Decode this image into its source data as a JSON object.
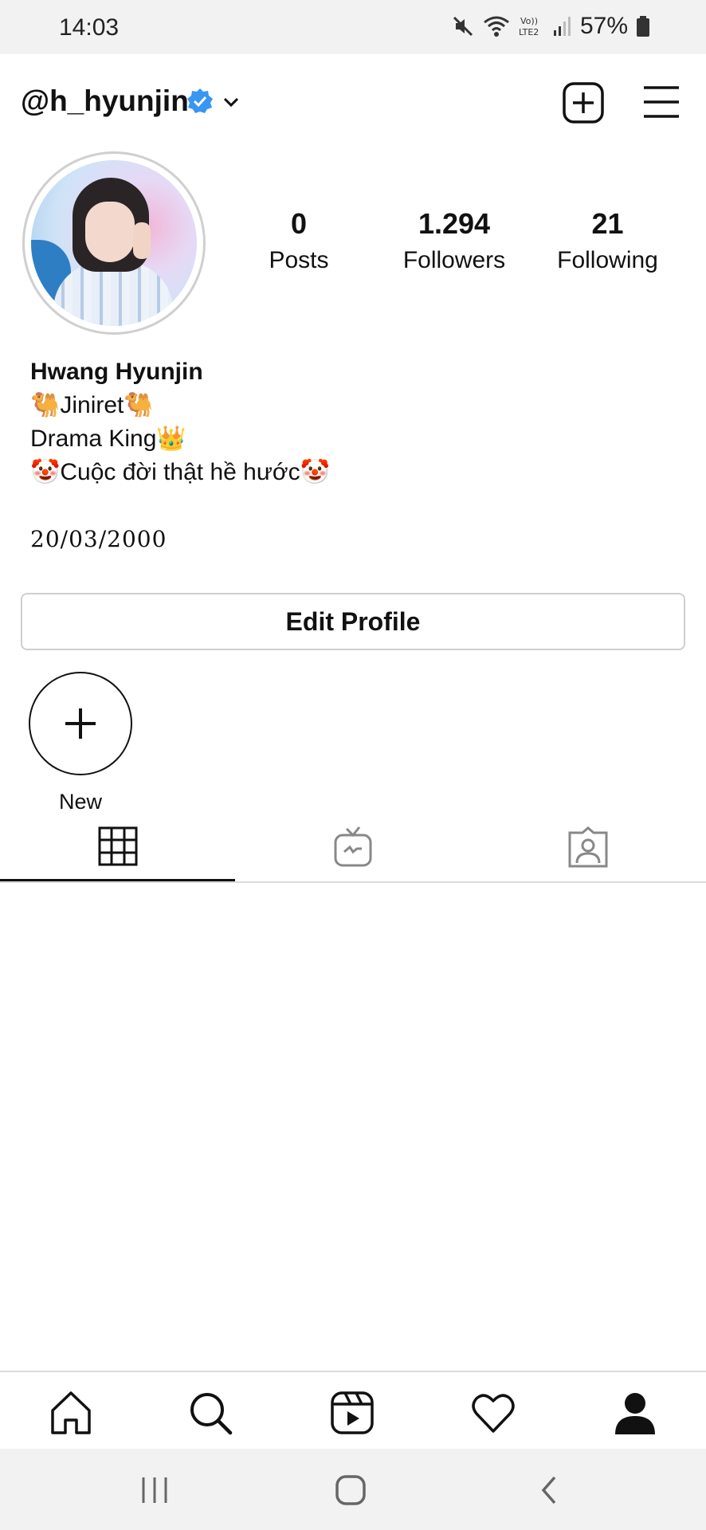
{
  "status_bar": {
    "time": "14:03",
    "battery": "57%",
    "icons": [
      "mute-icon",
      "wifi-icon",
      "volte-icon",
      "signal-icon",
      "battery-icon"
    ]
  },
  "header": {
    "username": "@h_hyunjin",
    "verified": true,
    "icons": [
      "verified-badge-icon",
      "chevron-down-icon",
      "new-post-icon",
      "menu-icon"
    ]
  },
  "profile": {
    "stats": [
      {
        "value": "0",
        "label": "Posts"
      },
      {
        "value": "1.294",
        "label": "Followers"
      },
      {
        "value": "21",
        "label": "Following"
      }
    ],
    "name": "Hwang Hyunjin",
    "bio_lines": [
      "🐫Jiniret🐫",
      "Drama King👑",
      "🤡Cuộc đời thật hề hước🤡"
    ],
    "date": "20/03/2000"
  },
  "actions": {
    "edit_profile": "Edit Profile"
  },
  "highlights": {
    "new_label": "New"
  },
  "tabs": [
    "grid-icon",
    "igtv-icon",
    "tagged-icon"
  ],
  "bottom_nav": [
    "home-icon",
    "search-icon",
    "reels-icon",
    "heart-icon",
    "profile-icon"
  ],
  "colors": {
    "verified_blue": "#3897f0",
    "border": "#dbdbdb",
    "text": "#111111"
  }
}
